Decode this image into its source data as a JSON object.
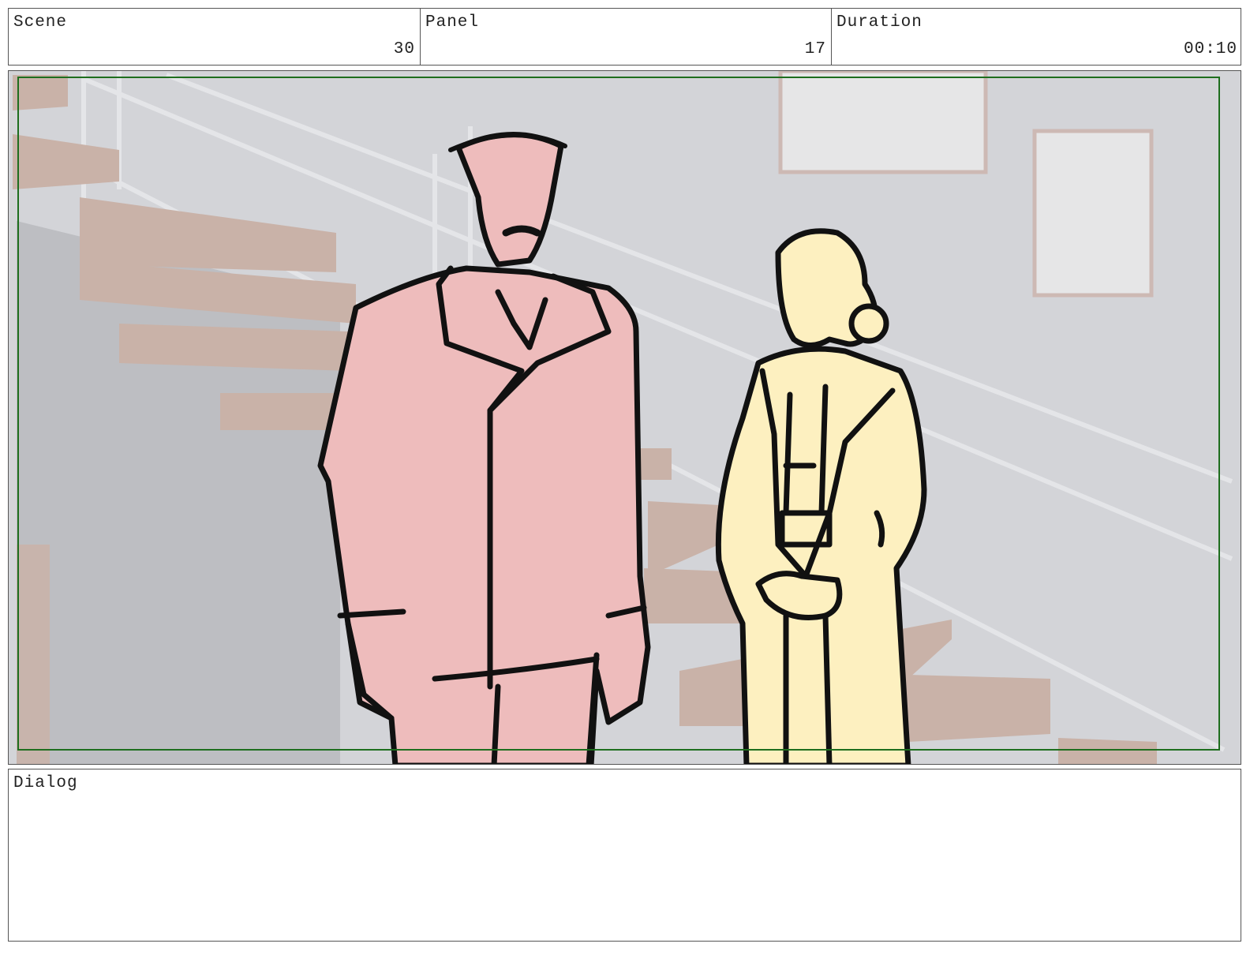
{
  "header": {
    "scene": {
      "label": "Scene",
      "value": "30"
    },
    "panel": {
      "label": "Panel",
      "value": "17"
    },
    "duration": {
      "label": "Duration",
      "value": "00:10"
    }
  },
  "artwork": {
    "safe_frame_color": "#1e6e1e",
    "wall_color": "#d3d4d8",
    "stair_color": "#c9b2a8",
    "man_fill_color": "#eebcbc",
    "woman_fill_color": "#fdf0c0"
  },
  "dialog": {
    "label": "Dialog",
    "text": ""
  }
}
